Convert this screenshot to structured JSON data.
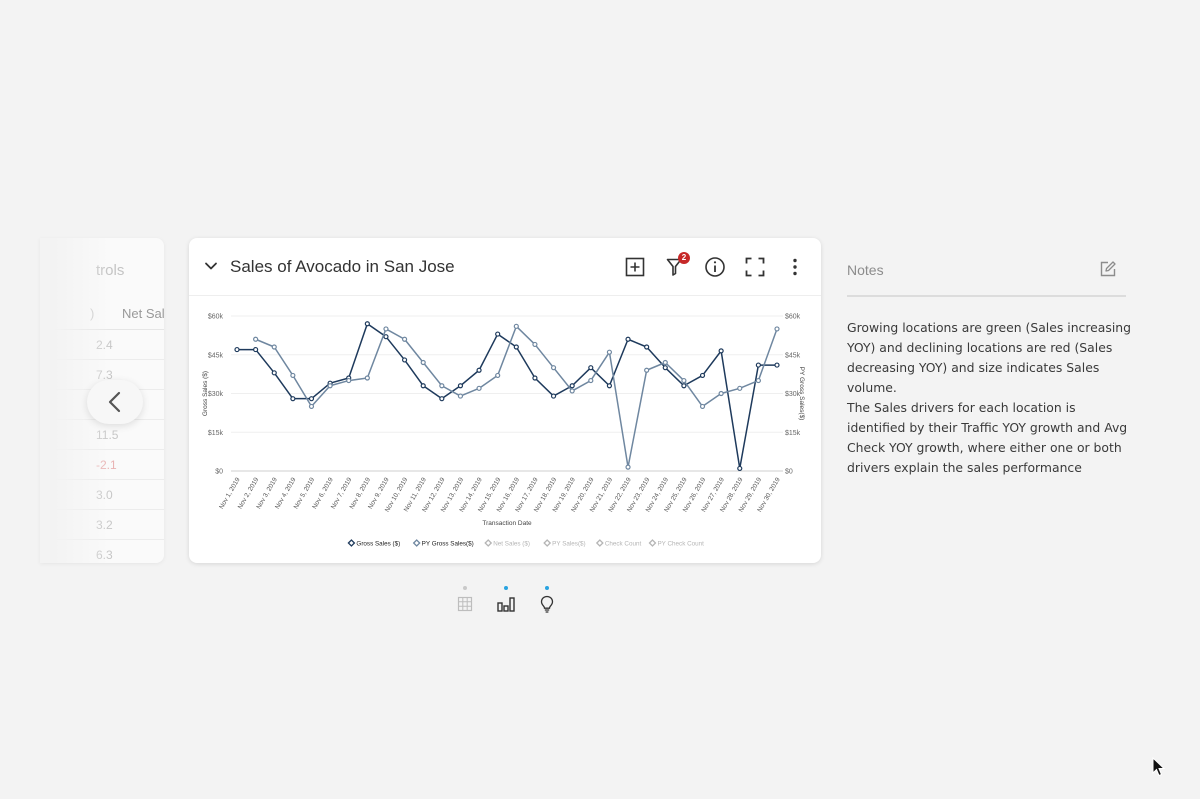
{
  "left_card": {
    "title_fragment": "trols",
    "header_fragment": ")",
    "column_header": "Net Sal",
    "values": [
      "2.4",
      "7.3",
      "",
      "11.5",
      "-2.1",
      "3.0",
      "3.2",
      "6.3"
    ]
  },
  "nav": {
    "prev_icon": "chevron-left-icon"
  },
  "card": {
    "title": "Sales of Avocado in San Jose",
    "filter_badge": "2",
    "icons": [
      "add-box-icon",
      "filter-icon",
      "info-icon",
      "fullscreen-icon",
      "more-vertical-icon"
    ]
  },
  "notes": {
    "title": "Notes",
    "paragraphs": [
      "Growing locations are green (Sales increasing YOY) and declining locations are red (Sales decreasing YOY) and size indicates Sales volume.",
      "The Sales drivers for each location is identified by their Traffic YOY growth and Avg Check YOY growth, where either one or both drivers explain the sales performance"
    ]
  },
  "view_switcher": [
    {
      "icon": "table-grid-icon",
      "active": false
    },
    {
      "icon": "bar-chart-icon",
      "active": true
    },
    {
      "icon": "lightbulb-icon",
      "active": true
    }
  ],
  "colors": {
    "gross": "#1e3a5c",
    "py_gross": "#6f87a0",
    "legend_inactive": "#b5b5b5",
    "accent_dot": "#29a3e0",
    "badge": "#c62828"
  },
  "chart_data": {
    "type": "line",
    "xlabel": "Transaction Date",
    "ylabel": "Gross Sales ($)",
    "y2label": "PY Gross Sales($)",
    "ylim": [
      0,
      60000
    ],
    "yticks": [
      "$0",
      "$15k",
      "$30k",
      "$45k",
      "$60k"
    ],
    "y2ticks": [
      "$0",
      "$15k",
      "$30k",
      "$45k",
      "$60k"
    ],
    "grid": true,
    "legend_position": "bottom",
    "x": [
      "Nov 1, 2019",
      "Nov 2, 2019",
      "Nov 3, 2019",
      "Nov 4, 2019",
      "Nov 5, 2019",
      "Nov 6, 2019",
      "Nov 7, 2019",
      "Nov 8, 2019",
      "Nov 9, 2019",
      "Nov 10, 2019",
      "Nov 11, 2019",
      "Nov 12, 2019",
      "Nov 13, 2019",
      "Nov 14, 2019",
      "Nov 15, 2019",
      "Nov 16, 2019",
      "Nov 17, 2019",
      "Nov 18, 2019",
      "Nov 19, 2019",
      "Nov 20, 2019",
      "Nov 21, 2019",
      "Nov 22, 2019",
      "Nov 23, 2019",
      "Nov 24, 2019",
      "Nov 25, 2019",
      "Nov 26, 2019",
      "Nov 27, 2019",
      "Nov 28, 2019",
      "Nov 29, 2019",
      "Nov 30, 2019"
    ],
    "series": [
      {
        "name": "Gross Sales ($)",
        "axis": "left",
        "values": [
          47000,
          47000,
          38000,
          28000,
          28000,
          34000,
          36000,
          57000,
          52000,
          43000,
          33000,
          28000,
          33000,
          39000,
          53000,
          48000,
          36000,
          29000,
          33000,
          40000,
          33000,
          51000,
          48000,
          40000,
          33000,
          37000,
          46500,
          1000,
          41000,
          41000
        ]
      },
      {
        "name": "PY Gross Sales($)",
        "axis": "right",
        "values": [
          null,
          51000,
          48000,
          37000,
          25000,
          33000,
          35000,
          36000,
          55000,
          51000,
          42000,
          33000,
          29000,
          32000,
          37000,
          56000,
          49000,
          40000,
          31000,
          35000,
          46000,
          1500,
          39000,
          42000,
          35000,
          25000,
          30000,
          32000,
          35000,
          55000
        ]
      }
    ],
    "inactive_legend": [
      "Net Sales ($)",
      "PY Sales($)",
      "Check Count",
      "PY Check Count"
    ]
  }
}
